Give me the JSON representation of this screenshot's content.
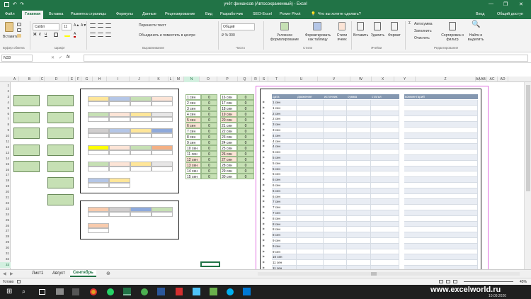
{
  "window": {
    "title": "учёт финансов (Автосохраненный) - Excel",
    "controls": [
      "—",
      "❐",
      "✕"
    ]
  },
  "ribbon_tabs": [
    "Файл",
    "Главная",
    "Вставка",
    "Разметка страницы",
    "Формулы",
    "Данные",
    "Рецензирование",
    "Вид",
    "Разработчик",
    "SEO-Excel",
    "Power Pivot"
  ],
  "search_hint": "Что вы хотите сделать?",
  "account": {
    "login": "Вход",
    "share": "Общий доступ"
  },
  "ribbon": {
    "paste": "Вставить",
    "font_name": "Calibri",
    "font_size": "11",
    "wrap_text": "Перенести текст",
    "merge_center": "Объединить и поместить в центре",
    "number_format": "Общий",
    "cond_format": "Условное форматирование",
    "format_table": "Форматировать как таблицу",
    "cell_styles": "Стили ячеек",
    "insert": "Вставить",
    "delete": "Удалить",
    "format": "Формат",
    "autosum": "Автосумма",
    "fill": "Заполнить",
    "clear": "Очистить",
    "sort_filter": "Сортировка и фильтр",
    "find_select": "Найти и выделить",
    "groups": {
      "clipboard": "Буфер обмена",
      "font": "Шрифт",
      "alignment": "Выравнивание",
      "number": "Число",
      "styles": "Стили",
      "cells": "Ячейки",
      "editing": "Редактирование"
    }
  },
  "formula_bar": {
    "name_box": "N33",
    "fx": "fx",
    "value": ""
  },
  "columns": [
    "A",
    "B",
    "C",
    "D",
    "E",
    "F",
    "G",
    "H",
    "I",
    "J",
    "K",
    "L",
    "M",
    "N",
    "O",
    "P",
    "Q",
    "R",
    "S",
    "T",
    "U",
    "V",
    "W",
    "X",
    "Y",
    "Z",
    "AA",
    "AB",
    "AC",
    "AD"
  ],
  "rows": [
    "1",
    "2",
    "3",
    "4",
    "5",
    "6",
    "7",
    "8",
    "9",
    "10",
    "11",
    "12",
    "13",
    "14",
    "15",
    "16",
    "17",
    "18",
    "19",
    "20",
    "21",
    "22",
    "23",
    "24",
    "25",
    "26",
    "27",
    "28",
    "29",
    "30",
    "31",
    "32",
    "33"
  ],
  "calendar_left": [
    {
      "d": "1 сен",
      "v": "0"
    },
    {
      "d": "2 сен",
      "v": "0"
    },
    {
      "d": "3 сен",
      "v": "0"
    },
    {
      "d": "4 сен",
      "v": "0"
    },
    {
      "d": "5 сен",
      "v": "0"
    },
    {
      "d": "6 сен",
      "v": "0"
    },
    {
      "d": "7 сен",
      "v": "0"
    },
    {
      "d": "8 сен",
      "v": "0"
    },
    {
      "d": "9 сен",
      "v": "0"
    },
    {
      "d": "10 сен",
      "v": "0"
    },
    {
      "d": "11 сен",
      "v": "0"
    },
    {
      "d": "12 сен",
      "v": "0"
    },
    {
      "d": "13 сен",
      "v": "0"
    },
    {
      "d": "14 сен",
      "v": "0"
    },
    {
      "d": "15 сен",
      "v": "0"
    }
  ],
  "calendar_right": [
    {
      "d": "16 сен",
      "v": "0"
    },
    {
      "d": "17 сен",
      "v": "0"
    },
    {
      "d": "18 сен",
      "v": "0"
    },
    {
      "d": "19 сен",
      "v": "0"
    },
    {
      "d": "20 сен",
      "v": "0"
    },
    {
      "d": "21 сен",
      "v": "0"
    },
    {
      "d": "22 сен",
      "v": "0"
    },
    {
      "d": "23 сен",
      "v": "0"
    },
    {
      "d": "24 сен",
      "v": "0"
    },
    {
      "d": "25 сен",
      "v": "0"
    },
    {
      "d": "26 сен",
      "v": "0"
    },
    {
      "d": "27 сен",
      "v": "0"
    },
    {
      "d": "28 сен",
      "v": "0"
    },
    {
      "d": "29 сен",
      "v": "0"
    },
    {
      "d": "30 сен",
      "v": "0"
    }
  ],
  "journal": {
    "headers": [
      "дата",
      "движение",
      "источник",
      "сумма",
      "статья",
      "",
      "комментарий"
    ],
    "dates": [
      "1 сен",
      "1 сен",
      "2 сен",
      "2 сен",
      "3 сен",
      "3 сен",
      "4 сен",
      "4 сен",
      "4 сен",
      "5 сен",
      "5 сен",
      "5 сен",
      "5 сен",
      "5 сен",
      "6 сен",
      "6 сен",
      "6 сен",
      "6 сен",
      "7 сен",
      "7 сен",
      "7 сен",
      "8 сен",
      "8 сен",
      "8 сен",
      "8 сен",
      "9 сен",
      "9 сен",
      "9 сен",
      "10 сен",
      "11 сен",
      "11 сен"
    ]
  },
  "sheet_tabs": [
    "Лист1",
    "Август",
    "Сентябрь"
  ],
  "active_sheet": "Сентябрь",
  "status": {
    "ready": "Готово",
    "zoom": "45%"
  },
  "taskbar": {
    "time": "10.09.2020",
    "watermark": "www.excelworld.ru"
  },
  "colors": {
    "excel_green": "#217346",
    "cell_green": "#c6e0b4",
    "orange": "#fce4d6",
    "yellow": "#ffe699",
    "blue": "#b4c6e7"
  }
}
